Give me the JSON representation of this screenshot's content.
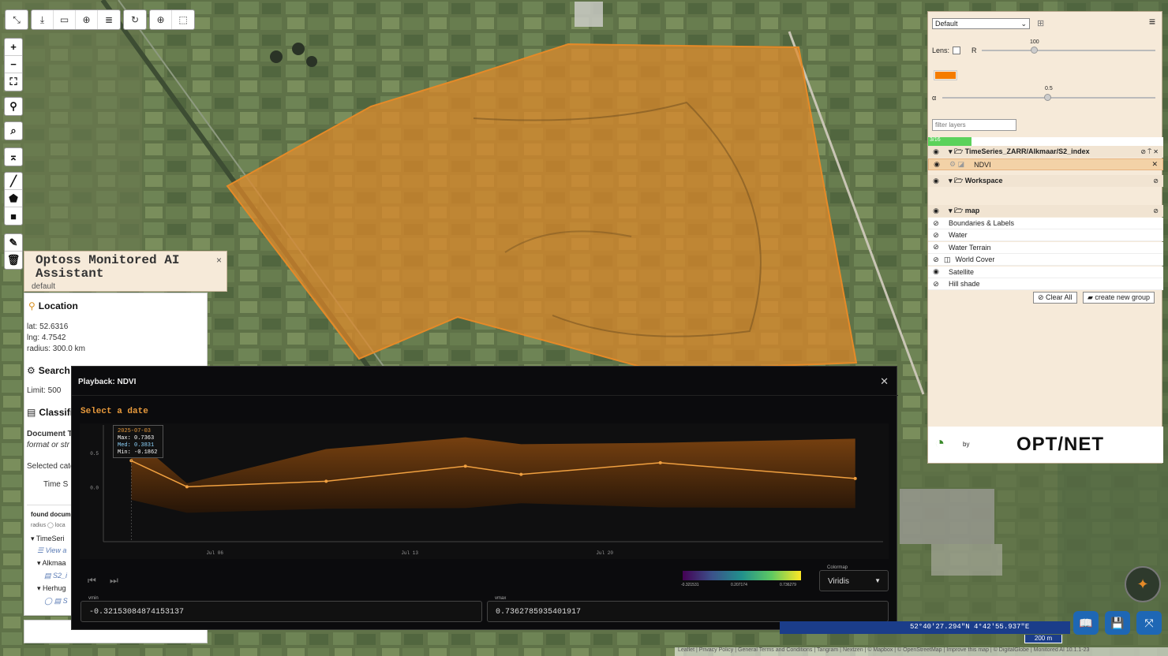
{
  "toolbar": {
    "icons": [
      "cursor-icon",
      "download-icon",
      "video-icon",
      "target-icon",
      "layers-icon",
      "history-icon",
      "plus-circle-icon",
      "select-icon"
    ]
  },
  "zoom": {
    "in": "+",
    "out": "−"
  },
  "assistant": {
    "title": "Optoss Monitored AI Assistant",
    "profile": "default",
    "close": "×",
    "location_heading": "Location",
    "lat": "lat: 52.6316",
    "lng": "lng: 4.7542",
    "radius": "radius: 300.0 km",
    "search_heading": "Search S",
    "limit": "Limit: 500",
    "classif_heading": "Classifi",
    "doc_type": "Document Ty",
    "format_text": "format or str",
    "selected": "Selected cate",
    "time": "Time S",
    "found": "found docume",
    "radius_local": "radius ◯ loca",
    "tree": [
      "TimeSeri",
      "View a",
      "Alkmaa",
      "S2_i",
      "Herhug",
      "S"
    ]
  },
  "layers_panel": {
    "preset": "Default",
    "lens_label": "Lens:",
    "r_label": "R",
    "r_value": "100",
    "alpha_label": "α",
    "alpha_value": "0.5",
    "lens_color": "#f57c00",
    "filter_placeholder": "filter layers",
    "progress": "3/16",
    "group1": "TimeSeries_ZARR/Alkmaar/S2_index",
    "group1_child": "NDVI",
    "group2": "Workspace",
    "group3": "map",
    "map_layers": [
      "Boundaries & Labels",
      "Water",
      "Water Terrain",
      "World Cover",
      "Satellite",
      "Hill shade"
    ],
    "clear_all": "Clear All",
    "new_group": "create new group",
    "by": "by",
    "brand": "OPT/NET"
  },
  "playback": {
    "title": "Playback: NDVI",
    "select_date": "Select a date",
    "tooltip": {
      "date": "2025-07-03",
      "max": "Max: 0.7363",
      "med": "Med: 0.3831",
      "min": "Min: -0.1862"
    },
    "colormap_label": "Colormap",
    "colormap": "Viridis",
    "cbar_ticks": [
      "-0.321531",
      "0.207174",
      "0.736279"
    ],
    "vmin_label": "vmin",
    "vmin": "-0.32153084874153137",
    "vmax_label": "vmax",
    "vmax": "0.7362785935401917"
  },
  "chart_data": {
    "type": "area",
    "x": [
      "2025-07-03",
      "2025-07-05",
      "2025-07-10",
      "2025-07-15",
      "2025-07-17",
      "2025-07-22",
      "2025-07-29"
    ],
    "series": [
      {
        "name": "Max",
        "values": [
          0.74,
          0.05,
          0.55,
          0.72,
          0.62,
          0.64,
          0.7
        ]
      },
      {
        "name": "Med",
        "values": [
          0.38,
          0.0,
          0.08,
          0.3,
          0.18,
          0.35,
          0.12
        ]
      },
      {
        "name": "Min",
        "values": [
          -0.19,
          -0.38,
          -0.32,
          -0.31,
          -0.24,
          -0.3,
          -0.31
        ]
      }
    ],
    "x_ticks": [
      "Jul 06",
      "Jul 13",
      "Jul 20"
    ],
    "y_ticks": [
      "0.5",
      "0.0"
    ],
    "ylim": [
      -0.8,
      0.9
    ]
  },
  "status": {
    "coords": "52°40'27.294\"N    4°42'55.937\"E",
    "scale": "200 m",
    "attribution": "Leaflet | Privacy Policy | General Terms and Conditions | Tangram | Nextzen | © Mapbox | © OpenStreetMap | Improve this map | © DigitalGlobe | Monitored AI 10.1.1-23"
  }
}
